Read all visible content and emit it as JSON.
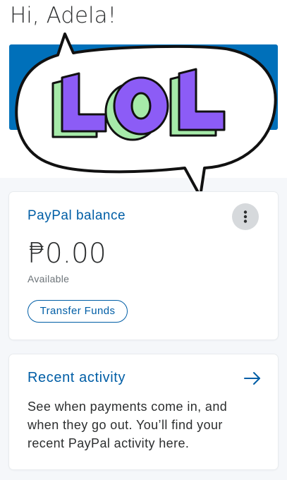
{
  "greeting": "Hi, Adela!",
  "sticker": {
    "text": "LOL",
    "icon": "lol-speech-bubble-sticker-icon"
  },
  "balance_card": {
    "title": "PayPal balance",
    "amount": "₱0.00",
    "subtitle": "Available",
    "transfer_button": "Transfer Funds",
    "more_icon": "vertical-dots-icon"
  },
  "activity_card": {
    "title": "Recent activity",
    "arrow_icon": "arrow-right-icon",
    "description": "See when payments come in, and when they go out. You’ll find your recent PayPal activity here."
  },
  "colors": {
    "brand_blue": "#0070ba",
    "link_blue": "#005ea6",
    "sticker_purple": "#8c5cf6",
    "sticker_green": "#9be8a6"
  }
}
